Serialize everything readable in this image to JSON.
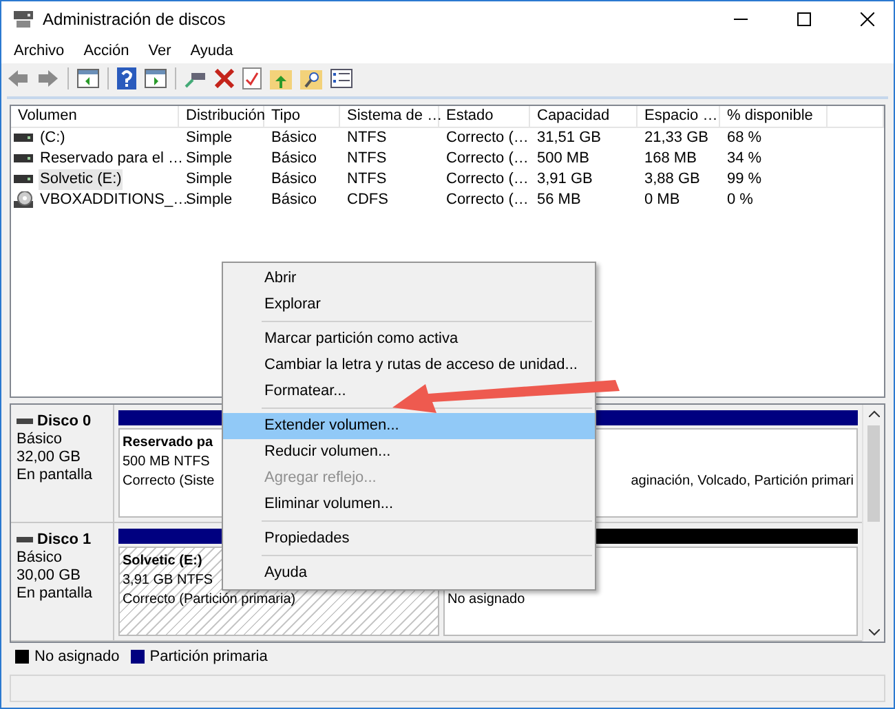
{
  "window": {
    "title": "Administración de discos"
  },
  "menu_bar": [
    "Archivo",
    "Acción",
    "Ver",
    "Ayuda"
  ],
  "volumes": {
    "columns": [
      "Volumen",
      "Distribución",
      "Tipo",
      "Sistema de …",
      "Estado",
      "Capacidad",
      "Espacio …",
      "% disponible"
    ],
    "rows": [
      {
        "kind": "disk",
        "selected": false,
        "cells": [
          "(C:)",
          "Simple",
          "Básico",
          "NTFS",
          "Correcto (…",
          "31,51 GB",
          "21,33 GB",
          "68 %"
        ]
      },
      {
        "kind": "disk",
        "selected": false,
        "cells": [
          "Reservado para el …",
          "Simple",
          "Básico",
          "NTFS",
          "Correcto (…",
          "500 MB",
          "168 MB",
          "34 %"
        ]
      },
      {
        "kind": "disk",
        "selected": true,
        "cells": [
          "Solvetic (E:)",
          "Simple",
          "Básico",
          "NTFS",
          "Correcto (…",
          "3,91 GB",
          "3,88 GB",
          "99 %"
        ]
      },
      {
        "kind": "cd",
        "selected": false,
        "cells": [
          "VBOXADDITIONS_…",
          "Simple",
          "Básico",
          "CDFS",
          "Correcto (…",
          "56 MB",
          "0 MB",
          "0 %"
        ]
      }
    ]
  },
  "disks": [
    {
      "name": "Disco 0",
      "type": "Básico",
      "size": "32,00 GB",
      "status": "En pantalla",
      "partitions": [
        {
          "kind": "primary",
          "selected": false,
          "name": "Reservado pa",
          "lines": [
            "500 MB NTFS",
            "Correcto (Siste"
          ]
        },
        {
          "kind": "primary",
          "selected": false,
          "lines": [
            "aginación, Volcado, Partición primari"
          ]
        }
      ]
    },
    {
      "name": "Disco 1",
      "type": "Básico",
      "size": "30,00 GB",
      "status": "En pantalla",
      "partitions": [
        {
          "kind": "primary",
          "selected": true,
          "name": "Solvetic  (E:)",
          "lines": [
            "3,91 GB NTFS",
            "Correcto (Partición primaria)"
          ]
        },
        {
          "kind": "unallocated",
          "selected": false,
          "lines": [
            "No asignado"
          ]
        }
      ]
    }
  ],
  "legend": [
    {
      "label": "No asignado",
      "color": "#000000"
    },
    {
      "label": "Partición primaria",
      "color": "#000080"
    }
  ],
  "context_menu": [
    {
      "kind": "item",
      "label": "Abrir",
      "selected": false,
      "disabled": false
    },
    {
      "kind": "item",
      "label": "Explorar",
      "selected": false,
      "disabled": false
    },
    {
      "kind": "separator"
    },
    {
      "kind": "item",
      "label": "Marcar partición como activa",
      "selected": false,
      "disabled": false
    },
    {
      "kind": "item",
      "label": "Cambiar la letra y rutas de acceso de unidad...",
      "selected": false,
      "disabled": false
    },
    {
      "kind": "item",
      "label": "Formatear...",
      "selected": false,
      "disabled": false
    },
    {
      "kind": "separator"
    },
    {
      "kind": "item",
      "label": "Extender volumen...",
      "selected": true,
      "disabled": false
    },
    {
      "kind": "item",
      "label": "Reducir volumen...",
      "selected": false,
      "disabled": false
    },
    {
      "kind": "item",
      "label": "Agregar reflejo...",
      "selected": false,
      "disabled": true
    },
    {
      "kind": "item",
      "label": "Eliminar volumen...",
      "selected": false,
      "disabled": false
    },
    {
      "kind": "separator"
    },
    {
      "kind": "item",
      "label": "Propiedades",
      "selected": false,
      "disabled": false
    },
    {
      "kind": "separator"
    },
    {
      "kind": "item",
      "label": "Ayuda",
      "selected": false,
      "disabled": false
    }
  ]
}
